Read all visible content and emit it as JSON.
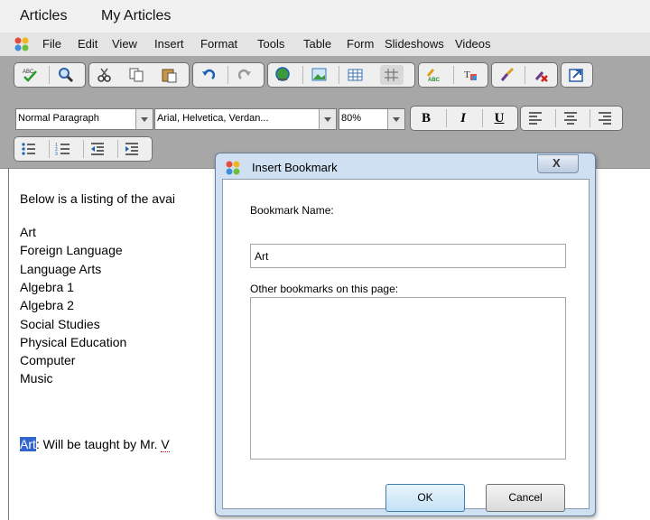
{
  "tabs": [
    "Articles",
    "My Articles"
  ],
  "menu": [
    "File",
    "Edit",
    "View",
    "Insert",
    "Format",
    "Tools",
    "Table",
    "Form",
    "Slideshows",
    "Videos"
  ],
  "format": {
    "paragraph_style": "Normal Paragraph",
    "font_family": "Arial, Helvetica, Verdan...",
    "font_size": "80%",
    "bold": "B",
    "italic": "I",
    "underline": "U"
  },
  "editor": {
    "intro": "Below is a listing of the avai",
    "subjects": [
      "Art",
      "Foreign Language",
      "Language Arts",
      "Algebra 1",
      "Algebra 2",
      "Social Studies",
      "Physical Education",
      "Computer",
      "Music"
    ],
    "selected_word": "Art",
    "line_rest": ": Will be taught by Mr. ",
    "line_tail": "V"
  },
  "dialog": {
    "title": "Insert Bookmark",
    "close": "X",
    "name_label": "Bookmark Name:",
    "name_value": "Art",
    "others_label": "Other bookmarks on this page:",
    "ok": "OK",
    "cancel": "Cancel"
  },
  "colors": {
    "selection": "#3366cc",
    "toolbar_bg": "#a7a7a7",
    "dialog_frame": "#cfe0f2"
  }
}
